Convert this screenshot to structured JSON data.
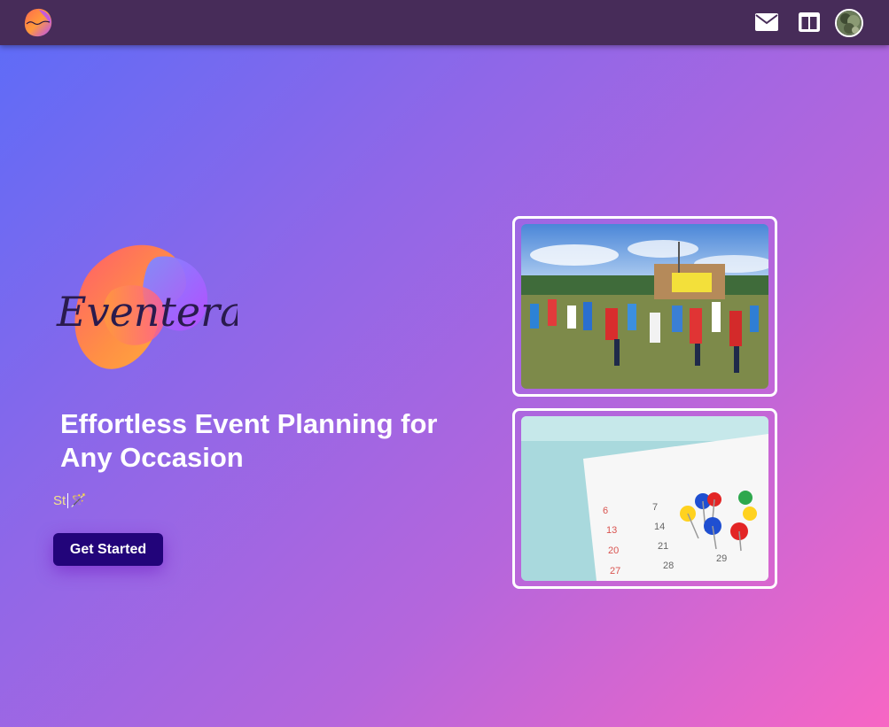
{
  "brand": {
    "name": "Eventerate",
    "logo_colors": [
      "#ff6a4d",
      "#ff9a3c",
      "#b64dff",
      "#7d6cff"
    ]
  },
  "topbar": {
    "background": "#472c59",
    "icons": [
      "mail-icon",
      "board-icon"
    ]
  },
  "hero": {
    "headline": "Effortless Event Planning for Any Occasion",
    "typing_text": "St",
    "typing_emoji": "🪄",
    "cta_label": "Get Started"
  },
  "images": [
    {
      "name": "outdoor-event-photo",
      "subject": "children playing outdoors at an event"
    },
    {
      "name": "calendar-pins-photo",
      "subject": "calendar with colored push pins"
    }
  ],
  "calendar_numbers": [
    "6",
    "7",
    "13",
    "14",
    "20",
    "21",
    "27",
    "28",
    "29"
  ]
}
